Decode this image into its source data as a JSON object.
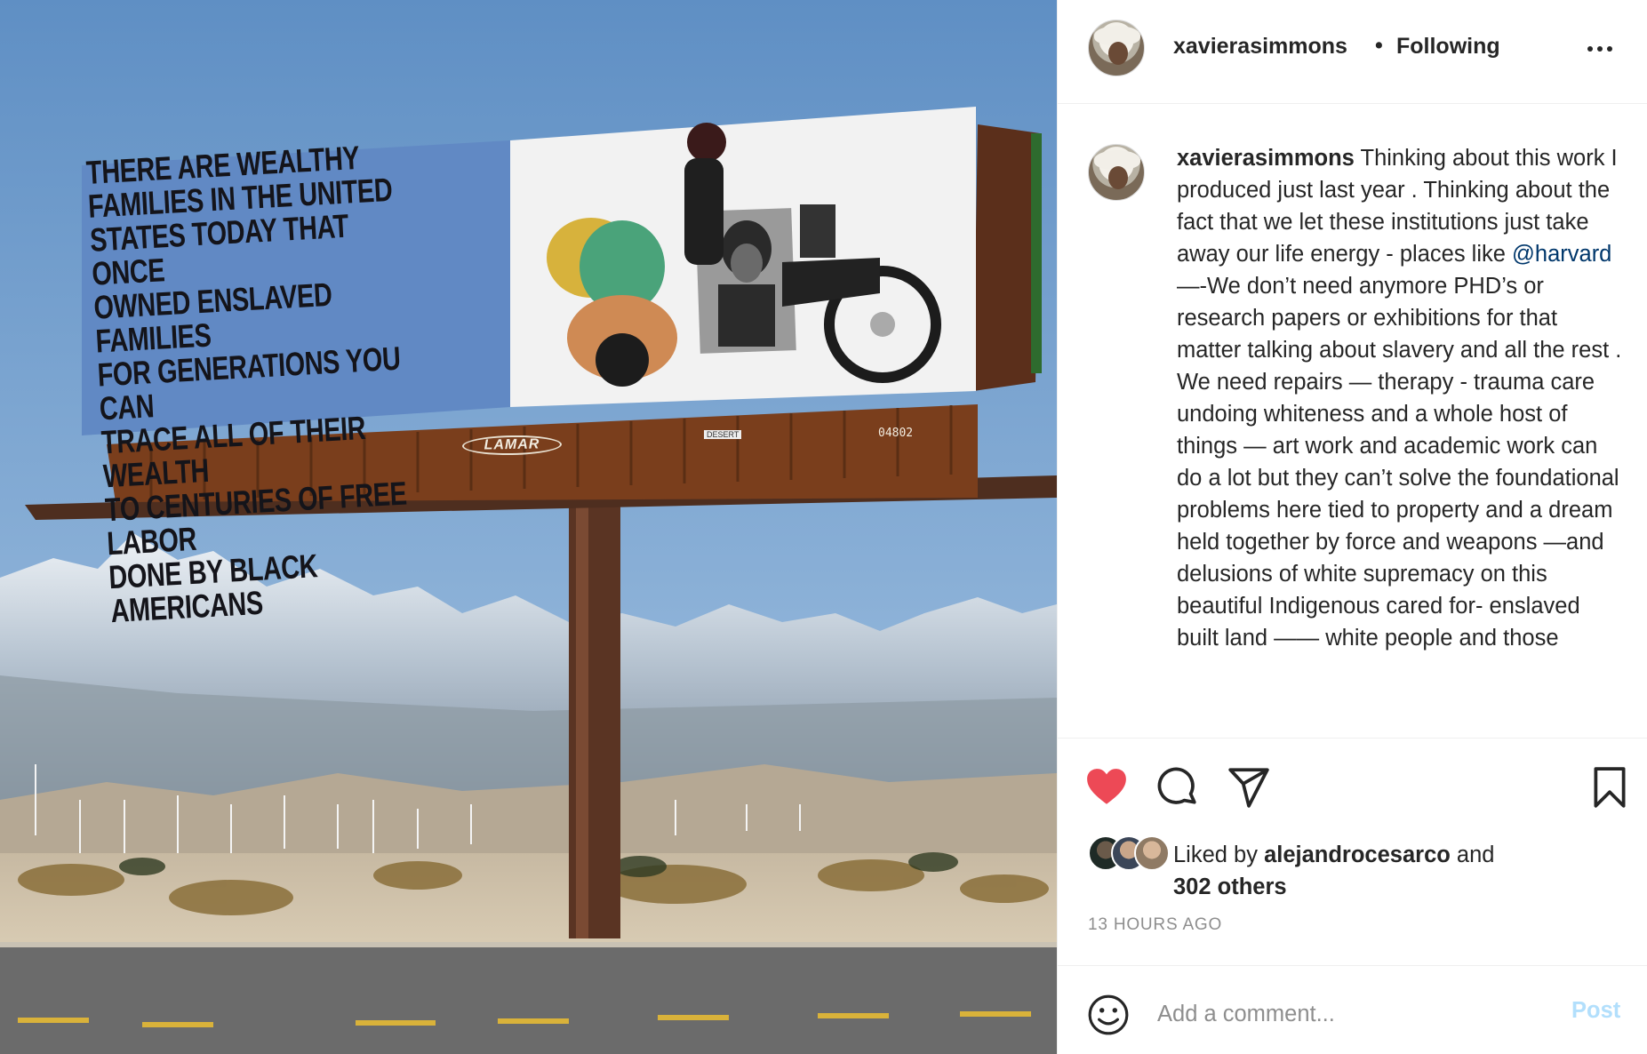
{
  "photo": {
    "billboard_text": "THERE ARE WEALTHY\nFAMILIES IN THE UNITED\nSTATES TODAY THAT ONCE\nOWNED ENSLAVED FAMILIES\nFOR GENERATIONS YOU CAN\nTRACE ALL OF THEIR WEALTH\nTO CENTURIES OF FREE LABOR\nDONE BY BLACK AMERICANS",
    "logo_text": "LAMAR",
    "panel_number": "04802",
    "sign_text": "DESERT"
  },
  "header": {
    "username": "xavierasimmons",
    "separator": "•",
    "follow_status": "Following",
    "more_icon": "more-horizontal-icon"
  },
  "caption": {
    "username": "xavierasimmons",
    "text_before_mention": " Thinking about this work I produced just last year . Thinking about the fact that we let these institutions just take away our life energy - places like ",
    "mention": "@harvard",
    "text_after_mention": " —-We don’t need anymore PHD’s or research papers or exhibitions for that matter talking about slavery and all the rest . We need repairs — therapy - trauma care undoing whiteness and a whole host of things — art work and academic work can do a lot but they can’t solve the foundational problems here tied to property and a dream held together by force and weapons —and delusions of white supremacy on this beautiful Indigenous cared for- enslaved built land —— white people and those"
  },
  "actions": {
    "like_icon": "heart-filled-icon",
    "comment_icon": "comment-icon",
    "share_icon": "paper-plane-icon",
    "save_icon": "bookmark-icon",
    "like_color": "#ed4956"
  },
  "likes": {
    "prefix": "Liked by ",
    "liker": "alejandrocesarco",
    "connector": " and",
    "others": "302 others"
  },
  "timestamp": "13 HOURS AGO",
  "comment_box": {
    "placeholder": "Add a comment...",
    "post_label": "Post",
    "post_color": "#b2dffc"
  }
}
